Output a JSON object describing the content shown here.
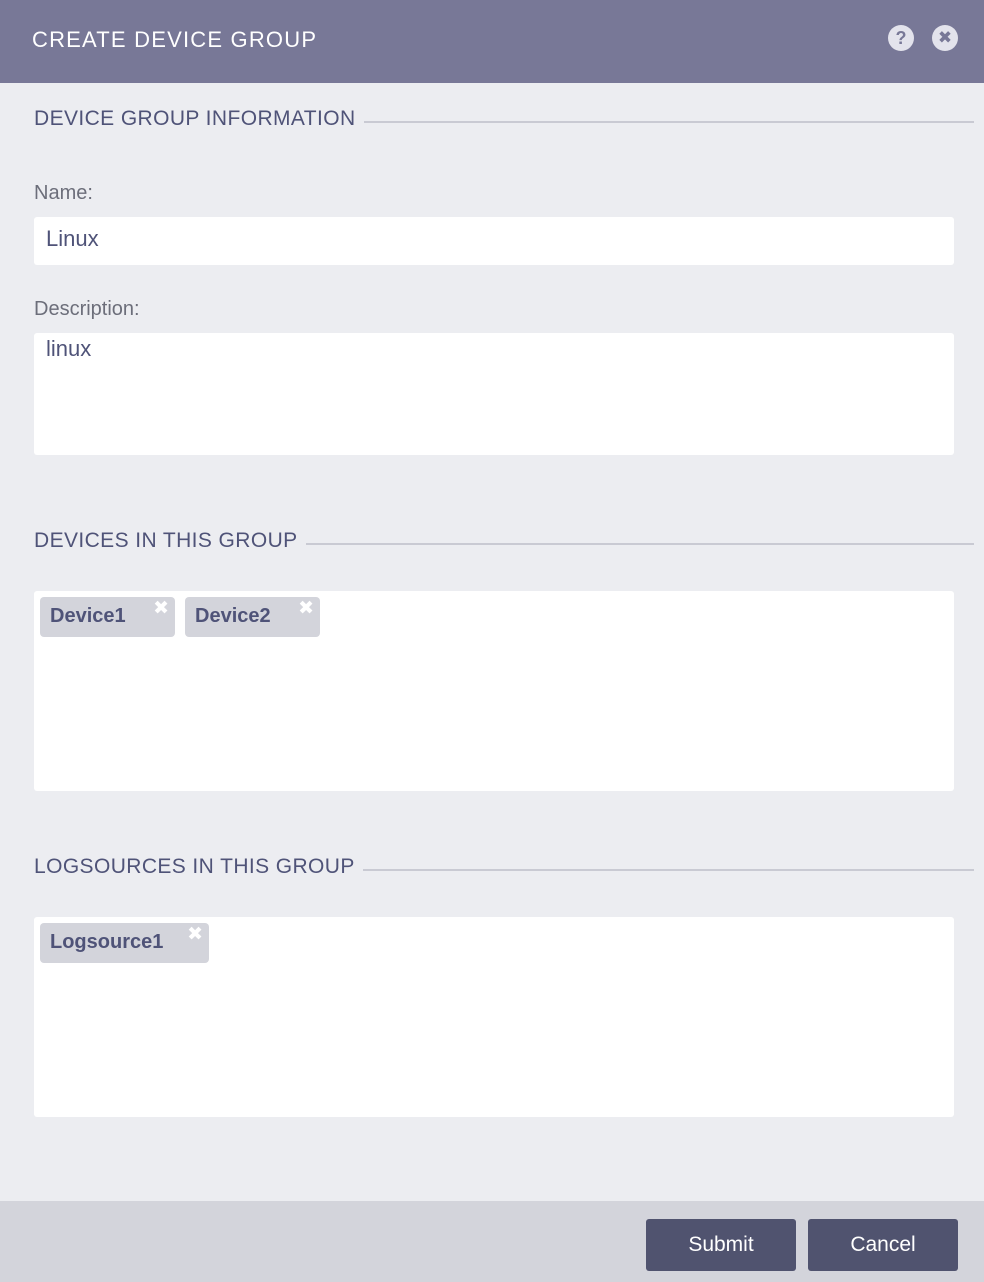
{
  "header": {
    "title": "CREATE DEVICE GROUP",
    "help_icon": "?",
    "close_icon": "✖"
  },
  "info_section": {
    "heading": "DEVICE GROUP INFORMATION",
    "name_label": "Name:",
    "name_value": "Linux",
    "description_label": "Description:",
    "description_value": "linux"
  },
  "devices_section": {
    "heading": "DEVICES IN THIS GROUP",
    "tags": [
      {
        "label": "Device1",
        "remove": "✖"
      },
      {
        "label": "Device2",
        "remove": "✖"
      }
    ]
  },
  "logsources_section": {
    "heading": "LOGSOURCES IN THIS GROUP",
    "tags": [
      {
        "label": "Logsource1",
        "remove": "✖"
      }
    ]
  },
  "footer": {
    "submit_label": "Submit",
    "cancel_label": "Cancel"
  },
  "colors": {
    "header_bg": "#787897",
    "body_bg": "#ecedf1",
    "heading_text": "#4f5378",
    "button_bg": "#50536f",
    "tag_bg": "#d3d4db"
  }
}
